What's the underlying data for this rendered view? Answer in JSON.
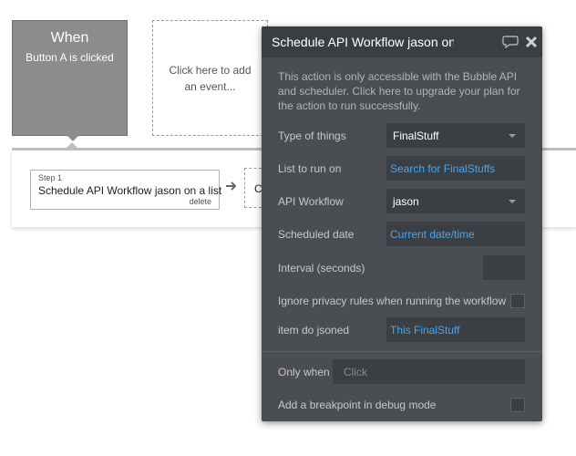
{
  "event": {
    "title": "When",
    "subtitle": "Button A is clicked",
    "add_event_label": "Click here to add an event..."
  },
  "workflow": {
    "step_number": "Step 1",
    "step_name": "Schedule API Workflow jason on a list",
    "delete_label": "delete",
    "next_step_label": "Cl"
  },
  "panel": {
    "title": "Schedule API Workflow jason on a",
    "notice": "This action is only accessible with the Bubble API and scheduler. Click here to upgrade your plan for the action to run successfully.",
    "fields": {
      "type_of_things": {
        "label": "Type of things",
        "value": "FinalStuff"
      },
      "list_to_run_on": {
        "label": "List to run on",
        "value": "Search for FinalStuffs"
      },
      "api_workflow": {
        "label": "API Workflow",
        "value": "jason"
      },
      "scheduled_date": {
        "label": "Scheduled date",
        "value": "Current date/time"
      },
      "interval": {
        "label": "Interval (seconds)",
        "value": ""
      },
      "ignore_privacy": {
        "label": "Ignore privacy rules when running the workflow",
        "checked": false
      },
      "item_do_jsoned": {
        "label": "item do jsoned",
        "value": "This FinalStuff"
      }
    },
    "only_when": {
      "label": "Only when",
      "placeholder": "Click"
    },
    "breakpoint": {
      "label": "Add a breakpoint in debug mode",
      "checked": false
    }
  },
  "colors": {
    "panel_bg": "#4a4d52",
    "header_bg": "#3a3d42",
    "field_bg": "#3b3e43",
    "dynamic_link": "#4aa5f0",
    "event_card": "#8c8c8c"
  },
  "icons": [
    "comment-icon",
    "close-icon",
    "arrow-right-icon",
    "chevron-down-icon"
  ]
}
